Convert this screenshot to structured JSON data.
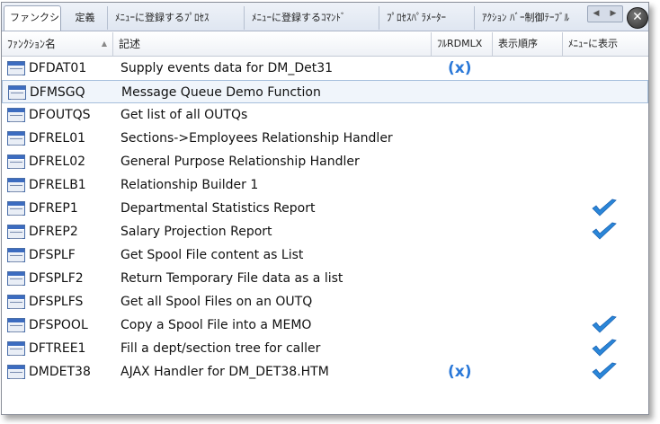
{
  "tabs": [
    "ファンクション",
    "定義",
    "ﾒﾆｭｰに登録するﾌﾟﾛｾｽ",
    "ﾒﾆｭｰに登録するｺﾏﾝﾄﾞ",
    "ﾌﾟﾛｾｽﾊﾟﾗﾒｰﾀｰ",
    "ｱｸｼｮﾝ ﾊﾞｰ制御ﾃｰﾌﾞﾙ"
  ],
  "tab_scroll": {
    "left": "◀",
    "right": "▶"
  },
  "close_glyph": "✕",
  "columns": {
    "name": "ﾌｧﾝｸｼｮﾝ名",
    "desc": "記述",
    "rdmlx": "ﾌﾙRDMLX",
    "order": "表示順序",
    "menu": "ﾒﾆｭｰに表示"
  },
  "rdmlx_glyph": "(x)",
  "rows": [
    {
      "name": "DFDAT01",
      "desc": "Supply events data for DM_Det31",
      "rdmlx": true,
      "menu": false
    },
    {
      "name": "DFMSGQ",
      "desc": "Message Queue Demo Function",
      "rdmlx": false,
      "menu": false,
      "selected": true
    },
    {
      "name": "DFOUTQS",
      "desc": "Get list of all OUTQs",
      "rdmlx": false,
      "menu": false
    },
    {
      "name": "DFREL01",
      "desc": "Sections->Employees Relationship Handler",
      "rdmlx": false,
      "menu": false
    },
    {
      "name": "DFREL02",
      "desc": "General Purpose Relationship Handler",
      "rdmlx": false,
      "menu": false
    },
    {
      "name": "DFRELB1",
      "desc": "Relationship Builder 1",
      "rdmlx": false,
      "menu": false
    },
    {
      "name": "DFREP1",
      "desc": "Departmental Statistics Report",
      "rdmlx": false,
      "menu": true
    },
    {
      "name": "DFREP2",
      "desc": "Salary Projection Report",
      "rdmlx": false,
      "menu": true
    },
    {
      "name": "DFSPLF",
      "desc": "Get Spool File content as List",
      "rdmlx": false,
      "menu": false
    },
    {
      "name": "DFSPLF2",
      "desc": "Return Temporary File data as a list",
      "rdmlx": false,
      "menu": false
    },
    {
      "name": "DFSPLFS",
      "desc": "Get all Spool Files on an OUTQ",
      "rdmlx": false,
      "menu": false
    },
    {
      "name": "DFSPOOL",
      "desc": "Copy a Spool File into a MEMO",
      "rdmlx": false,
      "menu": true
    },
    {
      "name": "DFTREE1",
      "desc": "Fill a dept/section tree for caller",
      "rdmlx": false,
      "menu": true
    },
    {
      "name": "DMDET38",
      "desc": "AJAX Handler for DM_DET38.HTM",
      "rdmlx": true,
      "menu": true
    }
  ],
  "colors": {
    "selection_bg": "#f0f5fb",
    "selection_border": "#a6bfdc",
    "check": "#2a86d8",
    "rdmlx": "#2a78d8"
  }
}
